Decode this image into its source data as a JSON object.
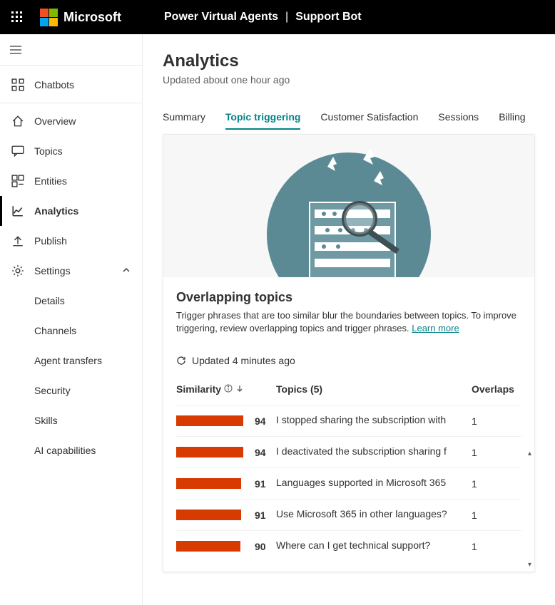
{
  "header": {
    "brand": "Microsoft",
    "app": "Power Virtual Agents",
    "bot": "Support Bot"
  },
  "sidebar": {
    "items": [
      {
        "label": "Chatbots"
      },
      {
        "label": "Overview"
      },
      {
        "label": "Topics"
      },
      {
        "label": "Entities"
      },
      {
        "label": "Analytics"
      },
      {
        "label": "Publish"
      },
      {
        "label": "Settings"
      }
    ],
    "settingsChildren": [
      {
        "label": "Details"
      },
      {
        "label": "Channels"
      },
      {
        "label": "Agent transfers"
      },
      {
        "label": "Security"
      },
      {
        "label": "Skills"
      },
      {
        "label": "AI capabilities"
      }
    ]
  },
  "page": {
    "title": "Analytics",
    "subtitle": "Updated about one hour ago"
  },
  "tabs": [
    {
      "label": "Summary"
    },
    {
      "label": "Topic triggering"
    },
    {
      "label": "Customer Satisfaction"
    },
    {
      "label": "Sessions"
    },
    {
      "label": "Billing"
    }
  ],
  "card": {
    "title": "Overlapping topics",
    "desc": "Trigger phrases that are too similar blur the boundaries between topics. To improve triggering, review overlapping topics and trigger phrases. ",
    "learnMore": "Learn more",
    "updated": "Updated 4 minutes ago",
    "columns": {
      "similarity": "Similarity",
      "topics": "Topics (5)",
      "overlaps": "Overlaps"
    },
    "rows": [
      {
        "similarity": 94,
        "topic": "I stopped sharing the subscription with",
        "overlaps": 1
      },
      {
        "similarity": 94,
        "topic": "I deactivated the subscription sharing f",
        "overlaps": 1
      },
      {
        "similarity": 91,
        "topic": "Languages supported in Microsoft 365",
        "overlaps": 1
      },
      {
        "similarity": 91,
        "topic": "Use Microsoft 365 in other languages?",
        "overlaps": 1
      },
      {
        "similarity": 90,
        "topic": "Where can I get technical support?",
        "overlaps": 1
      }
    ]
  }
}
